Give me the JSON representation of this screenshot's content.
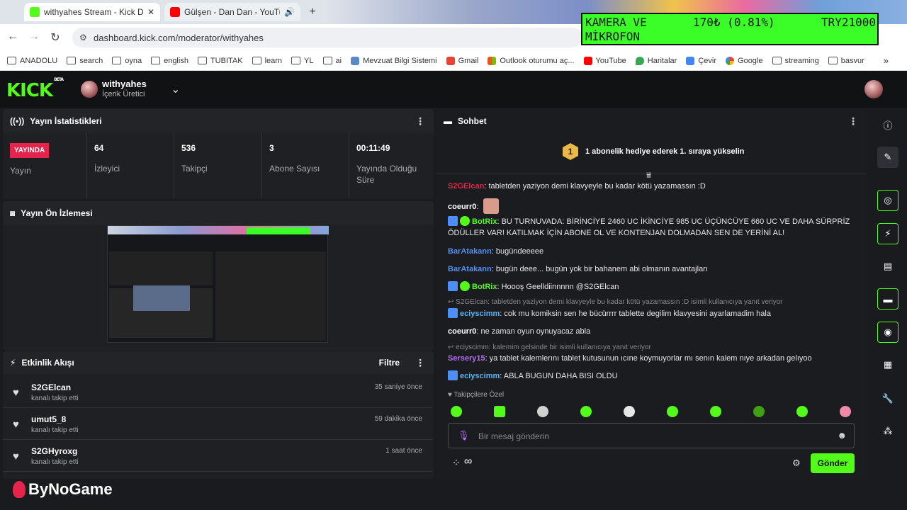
{
  "browser": {
    "tabs": [
      {
        "title": "withyahes Stream - Kick Dashbo"
      },
      {
        "title": "Gülşen - Dan Dan - YouTub"
      }
    ],
    "url": "dashboard.kick.com/moderator/withyahes",
    "bookmarks": [
      "ANADOLU",
      "search",
      "oyna",
      "english",
      "TUBITAK",
      "learn",
      "YL",
      "ai",
      "Mevzuat Bilgi Sistemi",
      "Gmail",
      "Outlook oturumu aç...",
      "YouTube",
      "Haritalar",
      "Çevir",
      "Google",
      "streaming",
      "basvur"
    ]
  },
  "overlay": {
    "line1a": "KAMERA VE",
    "line1b": "170₺ (0.81%)",
    "line1c": "TRY21000",
    "line2": "MİKROFON"
  },
  "header": {
    "user": "withyahes",
    "role": "İçerik Üretici"
  },
  "stats": {
    "title": "Yayın İstatistikleri",
    "live": "YAYINDA",
    "live_label": "Yayın",
    "items": [
      {
        "value": "64",
        "label": "İzleyici"
      },
      {
        "value": "536",
        "label": "Takipçi"
      },
      {
        "value": "3",
        "label": "Abone Sayısı"
      },
      {
        "value": "00:11:49",
        "label": "Yayında Olduğu Süre"
      }
    ]
  },
  "preview": {
    "title": "Yayın Ön İzlemesi"
  },
  "activity": {
    "title": "Etkinlik Akışı",
    "filter": "Filtre",
    "items": [
      {
        "name": "S2GElcan",
        "sub": "kanalı takip etti",
        "time": "35 saniye önce"
      },
      {
        "name": "umut5_8",
        "sub": "kanalı takip etti",
        "time": "59 dakika önce"
      },
      {
        "name": "S2GHyroxg",
        "sub": "kanalı takip etti",
        "time": "1 saat önce"
      }
    ]
  },
  "chat": {
    "title": "Sohbet",
    "gift_rank": "1",
    "gift_text": "1 abonelik hediye ederek 1. sıraya yükselin",
    "messages": [
      {
        "user": "S2GElcan",
        "text": ": tabletden yaziyon demi klavyeyle bu kadar kötü yazamassın :D",
        "color": "#e4244b"
      },
      {
        "user": "coeurr0",
        "text": ":",
        "color": "#ffffff"
      },
      {
        "user": "BotRix",
        "text": ": BU TURNUVADA: BİRİNCİYE 2460 UC İKİNCİYE 985 UC ÜÇÜNCÜYE 660 UC VE DAHA SÜRPRİZ ÖDÜLLER VAR! KATILMAK İÇİN ABONE OL VE KONTENJAN DOLMADAN SEN DE YERİNİ AL!",
        "color": "#53fc18"
      },
      {
        "user": "BarAtakann",
        "text": ": bugündeeeee",
        "color": "#4e8ef7"
      },
      {
        "user": "BarAtakann",
        "text": ": bugün deee... bugün yok bir bahanem abi olmanın avantajları",
        "color": "#4e8ef7"
      },
      {
        "user": "BotRix",
        "text": ": Hoooş Geelldiinnnnn @S2GElcan",
        "color": "#53fc18"
      },
      {
        "user": "eciyscimm",
        "text": ": cok mu komiksin sen he bücürrrr tablette degilim klavyesini ayarlamadim hala",
        "color": "#5ab4f0"
      },
      {
        "user": "coeurr0",
        "text": ": ne zaman oyun oynuyacaz abla",
        "color": "#ffffff"
      },
      {
        "user": "Sersery15",
        "text": ": ya tablet kalemlerını tablet kutusunun ıcıne koymuyorlar mı senın kalem nıye arkadan gelıyoo",
        "color": "#b46ef0"
      },
      {
        "user": "eciyscimm",
        "text": ": ABLA BUGUN DAHA BISI OLDU",
        "color": "#5ab4f0"
      }
    ],
    "reply1": "S2GElcan: tabletden yaziyon demi klavyeyle bu kadar kötü yazamassın :D isimli kullanıcıya yanıt veriyor",
    "reply2": "eciyscimm: kalemim gelsinde bir isimli kullanıcıya yanıt veriyor",
    "followers_only": "Takipçilere Özel",
    "input_placeholder": "Bir mesaj gönderin",
    "infinity": "∞",
    "send": "Gönder"
  },
  "watermark": "ByNoGame",
  "colors": {
    "brand": "#53fc18",
    "live": "#e4244b"
  }
}
